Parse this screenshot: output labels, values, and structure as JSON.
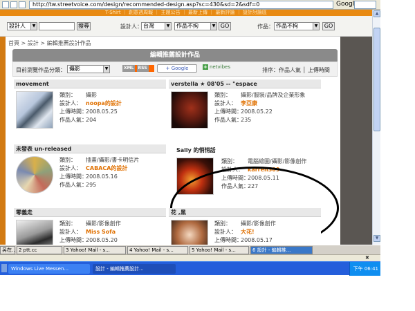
{
  "browser": {
    "url": "http://tw.streetvoice.com/design/recommended-design.asp?sc=430&sd=2&sdf=0",
    "search_engine": "Google"
  },
  "site": {
    "top_nav": "T-Shirt ｜ 創意週周報 ｜ 主題公告 ｜ 最新上傳 ｜ 最新評論 ｜ 設計討論區",
    "search": {
      "category_select": "設計人",
      "search_input": "",
      "search_button": "搜尋",
      "designer_label": "設計人：",
      "region_select": "台灣",
      "work_select": "作品不拘",
      "go1": "GO",
      "work_label": "作品：",
      "work_type_select": "作品不拘",
      "go2": "GO"
    },
    "breadcrumb": "首頁 > 設計 > 編輯推薦設計作品",
    "page_title": "編輯推薦設計作品",
    "filter": {
      "label": "目前瀏覽作品分類：",
      "category": "攝影",
      "rss_label": "RSS",
      "google_label": "+ Google",
      "netvibes_label": "netvibes",
      "sort_label": "排序：作品人氣 │ 上傳時間"
    },
    "field_labels": {
      "type": "類別：",
      "designer": "設計人：",
      "date": "上傳時間：",
      "pop": "作品人氣："
    },
    "cards": [
      {
        "title": "movement",
        "type": "攝影",
        "designer": "noopa的設計",
        "date": "2008.05.25",
        "pop": "204"
      },
      {
        "title": "verstella ★ 08'05 -- \"espace",
        "type": "攝影/服裝/品牌及企業形象",
        "designer": "李亞康",
        "date": "2008.05.22",
        "pop": "235"
      },
      {
        "title": "未發表 un-released",
        "type": "插畫/攝影/書卡明信片",
        "designer": "CABACA的設計",
        "date": "2008.05.16",
        "pop": "295"
      },
      {
        "title": "Sally 的悄悄話",
        "type": "電腦繪圖/攝影/影像創作",
        "designer": "karren309",
        "date": "2008.05.11",
        "pop": "227"
      },
      {
        "title": "零義走",
        "type": "攝影/影像創作",
        "designer": "Miss Sofa",
        "date": "2008.05.20",
        "pop": ""
      },
      {
        "title": "花 ,黑",
        "type": "攝影/影像創作",
        "designer": "大花!",
        "date": "2008.05.17",
        "pop": ""
      }
    ]
  },
  "taskbar_windows": [
    {
      "label": "另在..."
    },
    {
      "label": "2 ptt.cc"
    },
    {
      "label": "3 Yahoo! Mail - s..."
    },
    {
      "label": "4 Yahoo! Mail - s..."
    },
    {
      "label": "5 Yahoo! Mail - s..."
    },
    {
      "label": "6 設計 - 編輯推..."
    }
  ],
  "os_taskbar": {
    "item1": "Windows Live Messen...",
    "item2": "設計 - 編輯推薦設計...",
    "clock": "下午 06:41"
  },
  "colors": {
    "orange_bg": "#d27a12",
    "designer_text": "#e07000",
    "xp_taskbar": "#245edb"
  }
}
